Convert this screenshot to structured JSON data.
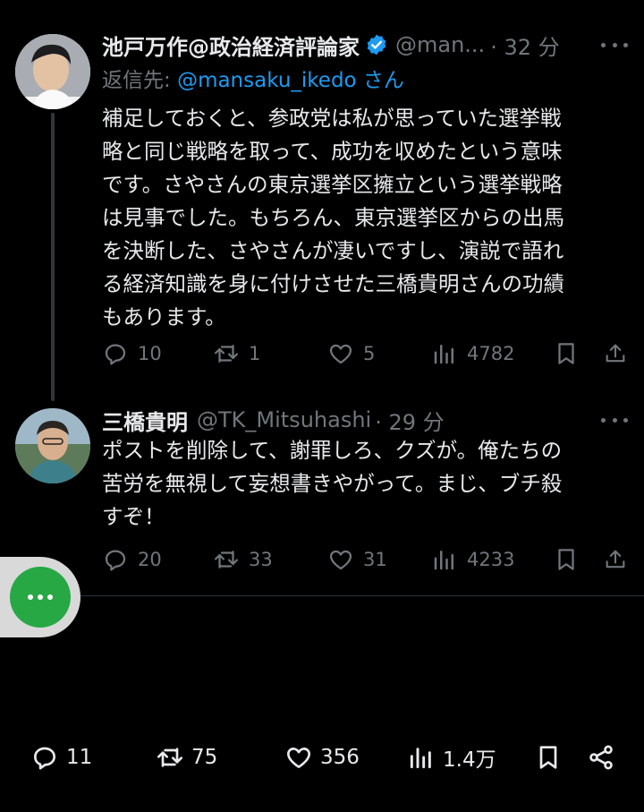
{
  "tweet1": {
    "name": "池戸万作@政治経済評論家",
    "handle": "@man...",
    "time": "· 32 分",
    "reply_prefix": "返信先: ",
    "reply_mention": "@mansaku_ikedo",
    "reply_suffix": " さん",
    "text": "補足しておくと、参政党は私が思っていた選挙戦\n略と同じ戦略を取って、成功を収めたという意味\nです。さやさんの東京選挙区擁立という選挙戦略\nは見事でした。もちろん、東京選挙区からの出馬\nを決断した、さやさんが凄いですし、演説で語れ\nる経済知識を身に付けさせた三橋貴明さんの功績\nもあります。",
    "replies": "10",
    "retweets": "1",
    "likes": "5",
    "views": "4782"
  },
  "tweet2": {
    "name": "三橋貴明",
    "handle": "@TK_Mitsuhashi",
    "time": "· 29 分",
    "text": "ポストを削除して、謝罪しろ、クズが。俺たちの\n苦労を無視して妄想書きやがって。まじ、ブチ殺\nすぞ！",
    "replies": "20",
    "retweets": "33",
    "likes": "31",
    "views": "4233"
  },
  "bottom_bar": {
    "replies": "11",
    "retweets": "75",
    "likes": "356",
    "views": "1.4万"
  },
  "colors": {
    "background": "#000000",
    "text": "#e7e9ea",
    "muted": "#71767b",
    "link": "#1d9bf0",
    "fab": "#27a844"
  },
  "icons": [
    "reply-icon",
    "retweet-icon",
    "like-icon",
    "views-icon",
    "bookmark-icon",
    "share-icon",
    "verified-badge-icon",
    "more-icon"
  ]
}
